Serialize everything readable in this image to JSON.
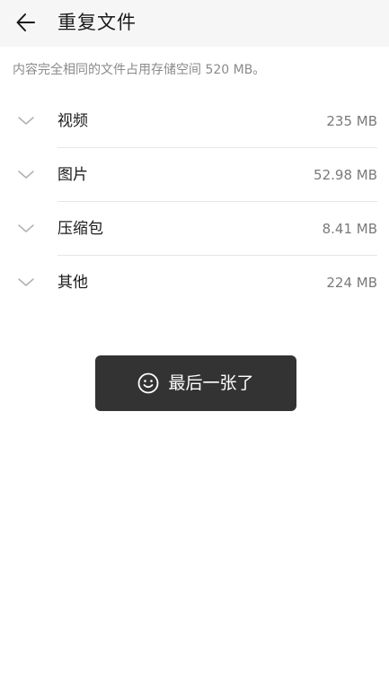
{
  "header": {
    "title": "重复文件",
    "back_icon": "arrow-left-icon"
  },
  "summary": "内容完全相同的文件占用存储空间 520 MB。",
  "categories": [
    {
      "label": "视频",
      "size": "235 MB",
      "icon": "chevron-down-icon"
    },
    {
      "label": "图片",
      "size": "52.98 MB",
      "icon": "chevron-down-icon"
    },
    {
      "label": "压缩包",
      "size": "8.41 MB",
      "icon": "chevron-down-icon"
    },
    {
      "label": "其他",
      "size": "224 MB",
      "icon": "chevron-down-icon"
    }
  ],
  "toast": {
    "text": "最后一张了",
    "icon": "smiley-icon"
  },
  "colors": {
    "header_bg": "#f6f6f6",
    "toast_bg": "#333333",
    "secondary_text": "#8a8a8a"
  }
}
